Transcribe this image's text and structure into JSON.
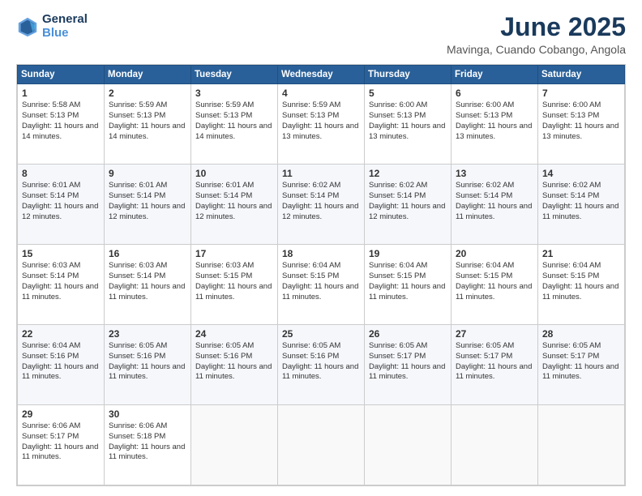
{
  "header": {
    "logo_line1": "General",
    "logo_line2": "Blue",
    "month": "June 2025",
    "location": "Mavinga, Cuando Cobango, Angola"
  },
  "weekdays": [
    "Sunday",
    "Monday",
    "Tuesday",
    "Wednesday",
    "Thursday",
    "Friday",
    "Saturday"
  ],
  "weeks": [
    [
      {
        "day": "1",
        "sunrise": "5:58 AM",
        "sunset": "5:13 PM",
        "daylight": "11 hours and 14 minutes."
      },
      {
        "day": "2",
        "sunrise": "5:59 AM",
        "sunset": "5:13 PM",
        "daylight": "11 hours and 14 minutes."
      },
      {
        "day": "3",
        "sunrise": "5:59 AM",
        "sunset": "5:13 PM",
        "daylight": "11 hours and 14 minutes."
      },
      {
        "day": "4",
        "sunrise": "5:59 AM",
        "sunset": "5:13 PM",
        "daylight": "11 hours and 13 minutes."
      },
      {
        "day": "5",
        "sunrise": "6:00 AM",
        "sunset": "5:13 PM",
        "daylight": "11 hours and 13 minutes."
      },
      {
        "day": "6",
        "sunrise": "6:00 AM",
        "sunset": "5:13 PM",
        "daylight": "11 hours and 13 minutes."
      },
      {
        "day": "7",
        "sunrise": "6:00 AM",
        "sunset": "5:13 PM",
        "daylight": "11 hours and 13 minutes."
      }
    ],
    [
      {
        "day": "8",
        "sunrise": "6:01 AM",
        "sunset": "5:14 PM",
        "daylight": "11 hours and 12 minutes."
      },
      {
        "day": "9",
        "sunrise": "6:01 AM",
        "sunset": "5:14 PM",
        "daylight": "11 hours and 12 minutes."
      },
      {
        "day": "10",
        "sunrise": "6:01 AM",
        "sunset": "5:14 PM",
        "daylight": "11 hours and 12 minutes."
      },
      {
        "day": "11",
        "sunrise": "6:02 AM",
        "sunset": "5:14 PM",
        "daylight": "11 hours and 12 minutes."
      },
      {
        "day": "12",
        "sunrise": "6:02 AM",
        "sunset": "5:14 PM",
        "daylight": "11 hours and 12 minutes."
      },
      {
        "day": "13",
        "sunrise": "6:02 AM",
        "sunset": "5:14 PM",
        "daylight": "11 hours and 11 minutes."
      },
      {
        "day": "14",
        "sunrise": "6:02 AM",
        "sunset": "5:14 PM",
        "daylight": "11 hours and 11 minutes."
      }
    ],
    [
      {
        "day": "15",
        "sunrise": "6:03 AM",
        "sunset": "5:14 PM",
        "daylight": "11 hours and 11 minutes."
      },
      {
        "day": "16",
        "sunrise": "6:03 AM",
        "sunset": "5:14 PM",
        "daylight": "11 hours and 11 minutes."
      },
      {
        "day": "17",
        "sunrise": "6:03 AM",
        "sunset": "5:15 PM",
        "daylight": "11 hours and 11 minutes."
      },
      {
        "day": "18",
        "sunrise": "6:04 AM",
        "sunset": "5:15 PM",
        "daylight": "11 hours and 11 minutes."
      },
      {
        "day": "19",
        "sunrise": "6:04 AM",
        "sunset": "5:15 PM",
        "daylight": "11 hours and 11 minutes."
      },
      {
        "day": "20",
        "sunrise": "6:04 AM",
        "sunset": "5:15 PM",
        "daylight": "11 hours and 11 minutes."
      },
      {
        "day": "21",
        "sunrise": "6:04 AM",
        "sunset": "5:15 PM",
        "daylight": "11 hours and 11 minutes."
      }
    ],
    [
      {
        "day": "22",
        "sunrise": "6:04 AM",
        "sunset": "5:16 PM",
        "daylight": "11 hours and 11 minutes."
      },
      {
        "day": "23",
        "sunrise": "6:05 AM",
        "sunset": "5:16 PM",
        "daylight": "11 hours and 11 minutes."
      },
      {
        "day": "24",
        "sunrise": "6:05 AM",
        "sunset": "5:16 PM",
        "daylight": "11 hours and 11 minutes."
      },
      {
        "day": "25",
        "sunrise": "6:05 AM",
        "sunset": "5:16 PM",
        "daylight": "11 hours and 11 minutes."
      },
      {
        "day": "26",
        "sunrise": "6:05 AM",
        "sunset": "5:17 PM",
        "daylight": "11 hours and 11 minutes."
      },
      {
        "day": "27",
        "sunrise": "6:05 AM",
        "sunset": "5:17 PM",
        "daylight": "11 hours and 11 minutes."
      },
      {
        "day": "28",
        "sunrise": "6:05 AM",
        "sunset": "5:17 PM",
        "daylight": "11 hours and 11 minutes."
      }
    ],
    [
      {
        "day": "29",
        "sunrise": "6:06 AM",
        "sunset": "5:17 PM",
        "daylight": "11 hours and 11 minutes."
      },
      {
        "day": "30",
        "sunrise": "6:06 AM",
        "sunset": "5:18 PM",
        "daylight": "11 hours and 11 minutes."
      },
      null,
      null,
      null,
      null,
      null
    ]
  ]
}
